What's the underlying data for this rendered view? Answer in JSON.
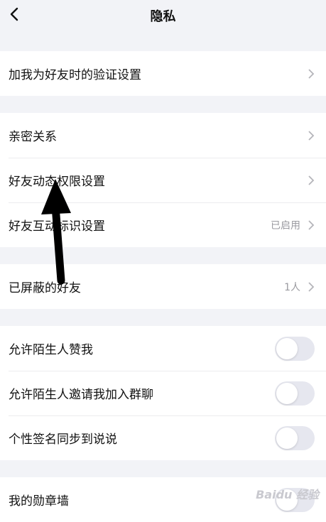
{
  "header": {
    "title": "隐私",
    "back_icon": "back-chevron-icon"
  },
  "sections": [
    {
      "rows": [
        {
          "label": "加我为好友时的验证设置",
          "type": "link"
        }
      ]
    },
    {
      "rows": [
        {
          "label": "亲密关系",
          "type": "link"
        },
        {
          "label": "好友动态权限设置",
          "type": "link"
        },
        {
          "label": "好友互动标识设置",
          "type": "link",
          "value": "已启用"
        }
      ]
    },
    {
      "rows": [
        {
          "label": "已屏蔽的好友",
          "type": "link",
          "value": "1人"
        }
      ]
    },
    {
      "rows": [
        {
          "label": "允许陌生人赞我",
          "type": "toggle",
          "on": false
        },
        {
          "label": "允许陌生人邀请我加入群聊",
          "type": "toggle",
          "on": false
        },
        {
          "label": "个性签名同步到说说",
          "type": "toggle",
          "on": false
        }
      ]
    },
    {
      "rows": [
        {
          "label": "我的勋章墙",
          "type": "toggle",
          "on": false
        }
      ]
    }
  ],
  "colors": {
    "background": "#f2f3f7",
    "toggle_off": "#e6e7ef",
    "secondary_text": "#9a9aa0"
  },
  "watermark": "Baidu 经验"
}
